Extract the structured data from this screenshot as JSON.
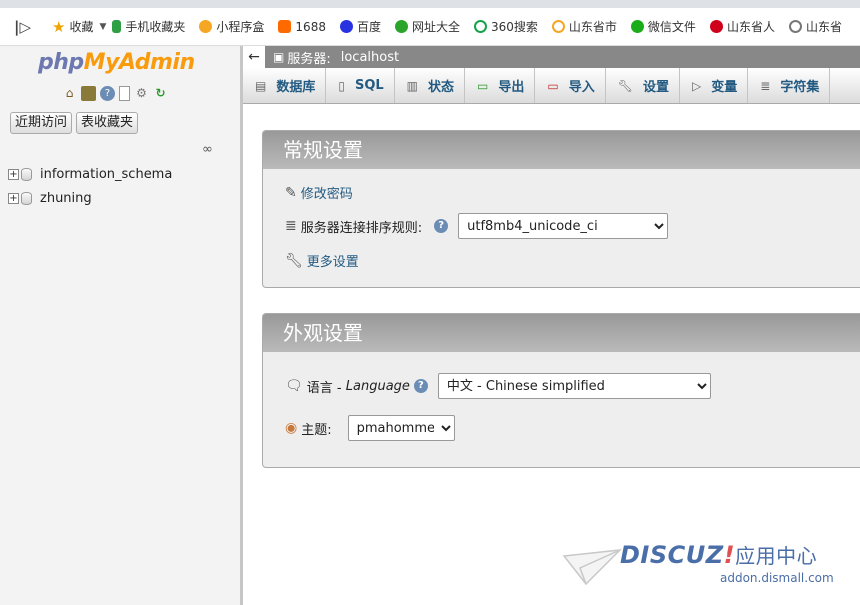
{
  "bookmarks": {
    "items": [
      {
        "label": "收藏",
        "color": "#f0a400"
      },
      {
        "label": "手机收藏夹",
        "color": "#2ea043"
      },
      {
        "label": "小程序盒",
        "color": "#f5a623"
      },
      {
        "label": "1688",
        "color": "#ff6a00"
      },
      {
        "label": "百度",
        "color": "#2932e1"
      },
      {
        "label": "网址大全",
        "color": "#2aa52a"
      },
      {
        "label": "360搜索",
        "color": "#16a34a"
      },
      {
        "label": "山东省市",
        "color": "#1f7ae0"
      },
      {
        "label": "微信文件",
        "color": "#1aad19"
      },
      {
        "label": "山东省人",
        "color": "#d0021b"
      },
      {
        "label": "山东省",
        "color": "#777777"
      }
    ]
  },
  "logo": {
    "part1": "php",
    "part2": "MyAdmin"
  },
  "nav": {
    "recent_label": "近期访问",
    "favorites_label": "表收藏夹",
    "databases": [
      "information_schema",
      "zhuning"
    ]
  },
  "breadcrumb": {
    "label": "服务器:",
    "value": "localhost"
  },
  "tabs": [
    {
      "label": "数据库",
      "icon": "database-icon"
    },
    {
      "label": "SQL",
      "icon": "sql-icon"
    },
    {
      "label": "状态",
      "icon": "status-icon"
    },
    {
      "label": "导出",
      "icon": "export-icon"
    },
    {
      "label": "导入",
      "icon": "import-icon"
    },
    {
      "label": "设置",
      "icon": "wrench-icon"
    },
    {
      "label": "变量",
      "icon": "variables-icon"
    },
    {
      "label": "字符集",
      "icon": "charset-icon"
    }
  ],
  "general": {
    "title": "常规设置",
    "change_password": "修改密码",
    "collation_label": "服务器连接排序规则:",
    "collation_value": "utf8mb4_unicode_ci",
    "more_settings": "更多设置"
  },
  "appearance": {
    "title": "外观设置",
    "language_label": "语言 - ",
    "language_label_en": "Language",
    "language_value": "中文 - Chinese simplified",
    "theme_label": "主题:",
    "theme_value": "pmahomme"
  },
  "watermark": {
    "brand": "DISCUZ",
    "excl": "!",
    "suffix": "应用中心",
    "url": "addon.dismall.com"
  }
}
